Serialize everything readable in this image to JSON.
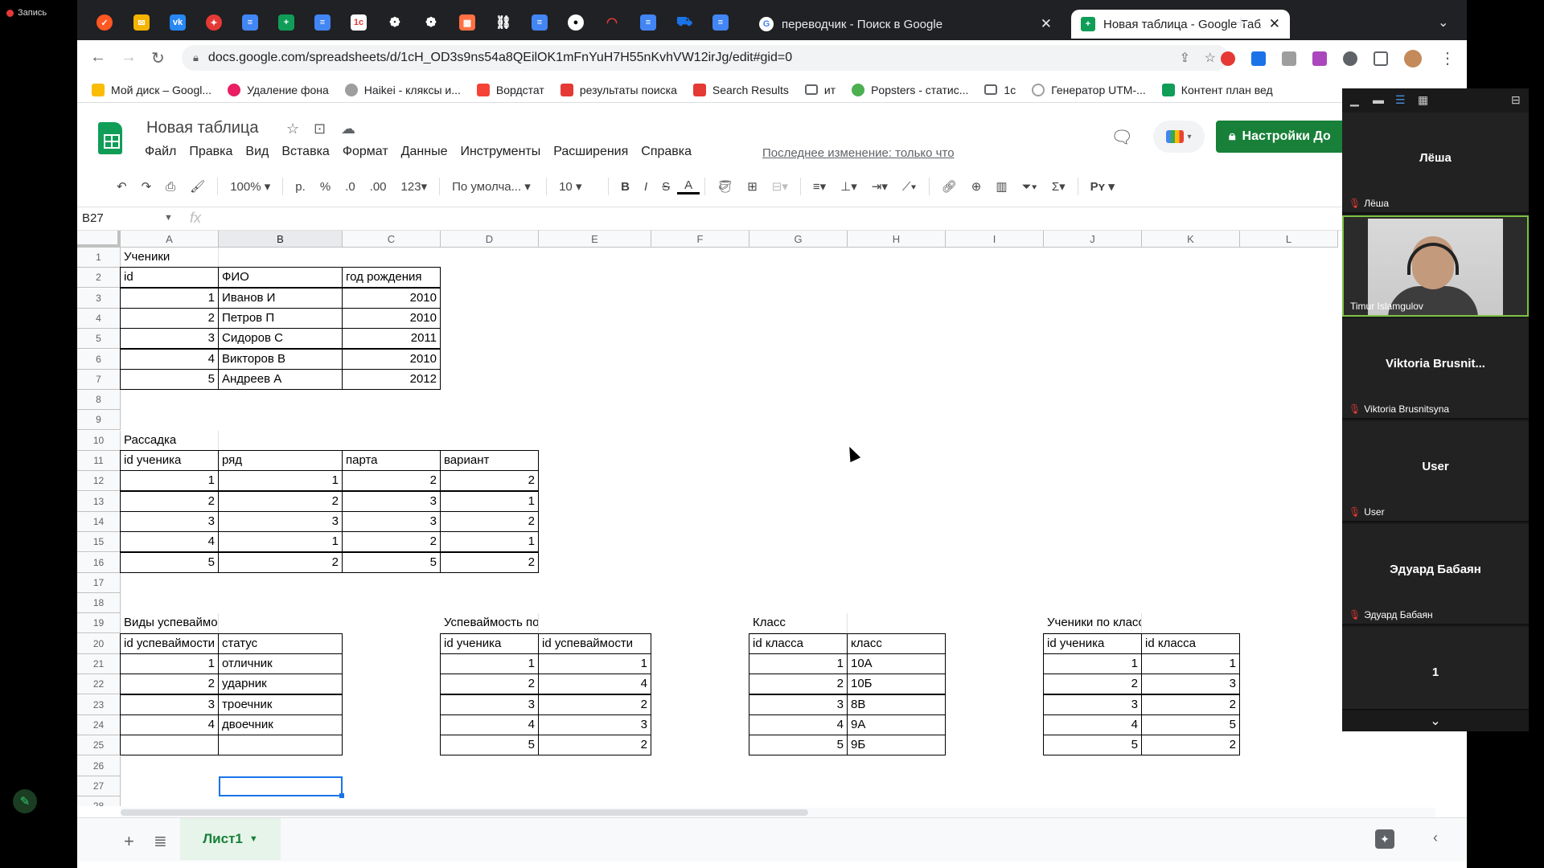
{
  "recording": {
    "label": "Запись"
  },
  "tabs": {
    "items": [
      {
        "title": "переводчик - Поиск в Google"
      },
      {
        "title": "Новая таблица - Google Табли"
      }
    ]
  },
  "address": {
    "url": "docs.google.com/spreadsheets/d/1cH_OD3s9ns54a8QEilOK1mFnYuH7H55nKvhVW12irJg/edit#gid=0"
  },
  "bookmarks": [
    {
      "label": "Мой диск – Googl...",
      "color": "#fbbc04"
    },
    {
      "label": "Удаление фона",
      "color": "#e91e63"
    },
    {
      "label": "Haikei - кляксы и...",
      "color": "#9e9e9e"
    },
    {
      "label": "Вордстат",
      "color": "#f44336"
    },
    {
      "label": "результаты поиска",
      "color": "#e53935"
    },
    {
      "label": "Search Results",
      "color": "#e53935"
    },
    {
      "label": "ит",
      "color": "#ffffff"
    },
    {
      "label": "Popsters - статис...",
      "color": "#4caf50"
    },
    {
      "label": "1с",
      "color": "#ffffff"
    },
    {
      "label": "Генератор UTM-...",
      "color": "#9e9e9e"
    },
    {
      "label": "Контент план вед",
      "color": "#0f9d58"
    }
  ],
  "doc": {
    "title": "Новая таблица",
    "menu": [
      "Файл",
      "Правка",
      "Вид",
      "Вставка",
      "Формат",
      "Данные",
      "Инструменты",
      "Расширения",
      "Справка"
    ],
    "last_edit": "Последнее изменение: только что",
    "share_label": "Настройки До"
  },
  "format_toolbar": {
    "zoom": "100%",
    "currency": "р.",
    "percent": "%",
    "dec_less": ".0",
    "dec_more": ".00",
    "more_formats": "123",
    "font": "По умолча...",
    "font_size": "10",
    "bold": "B",
    "italic": "I",
    "strike": "S",
    "text_color": "A",
    "input_tools": "Рʏ"
  },
  "formula_bar": {
    "name_box": "B27",
    "fx": "fx",
    "content": ""
  },
  "columns": [
    "A",
    "B",
    "C",
    "D",
    "E",
    "F",
    "G",
    "H",
    "I",
    "J",
    "K",
    "L"
  ],
  "rows": [
    "1",
    "2",
    "3",
    "4",
    "5",
    "6",
    "7",
    "8",
    "9",
    "10",
    "11",
    "12",
    "13",
    "14",
    "15",
    "16",
    "17",
    "18",
    "19",
    "20",
    "21",
    "22",
    "23",
    "24",
    "25",
    "26",
    "27",
    "28"
  ],
  "cells": {
    "A1": "Ученики",
    "A2": "id",
    "B2": "ФИО",
    "C2": "год рождения",
    "A3": "1",
    "B3": "Иванов И",
    "C3": "2010",
    "A4": "2",
    "B4": "Петров П",
    "C4": "2010",
    "A5": "3",
    "B5": "Сидоров С",
    "C5": "2011",
    "A6": "4",
    "B6": "Викторов В",
    "C6": "2010",
    "A7": "5",
    "B7": "Андреев А",
    "C7": "2012",
    "A10": "Рассадка",
    "A11": "id ученика",
    "B11": "ряд",
    "C11": "парта",
    "D11": "вариант",
    "A12": "1",
    "B12": "1",
    "C12": "2",
    "D12": "2",
    "A13": "2",
    "B13": "2",
    "C13": "3",
    "D13": "1",
    "A14": "3",
    "B14": "3",
    "C14": "3",
    "D14": "2",
    "A15": "4",
    "B15": "1",
    "C15": "2",
    "D15": "1",
    "A16": "5",
    "B16": "2",
    "C16": "5",
    "D16": "2",
    "A19": "Виды успеваймости",
    "A20": "id успеваймости",
    "B20": "статус",
    "A21": "1",
    "B21": "отличник",
    "A22": "2",
    "B22": "ударник",
    "A23": "3",
    "B23": "троечник",
    "A24": "4",
    "B24": "двоечник",
    "D19": "Успеваймость по ученикам",
    "D20": "id ученика",
    "E20": "id успеваймости",
    "D21": "1",
    "E21": "1",
    "D22": "2",
    "E22": "4",
    "D23": "3",
    "E23": "2",
    "D24": "4",
    "E24": "3",
    "D25": "5",
    "E25": "2",
    "G19": "Класс",
    "G20": "id класса",
    "H20": "класс",
    "G21": "1",
    "H21": "10А",
    "G22": "2",
    "H22": "10Б",
    "G23": "3",
    "H23": "8В",
    "G24": "4",
    "H24": "9А",
    "G25": "5",
    "H25": "9Б",
    "J19": "Ученики по классам",
    "J20": "id ученика",
    "K20": "id класса",
    "J21": "1",
    "K21": "1",
    "J22": "2",
    "K22": "3",
    "J23": "3",
    "K23": "2",
    "J24": "4",
    "K24": "5",
    "J25": "5",
    "K25": "2"
  },
  "sheet_tabs": [
    {
      "label": "Лист1"
    }
  ],
  "participants": [
    {
      "name": "Лёша",
      "label": "Лёша",
      "video": false
    },
    {
      "name": "",
      "label": "Timur Islamgulov",
      "video": true
    },
    {
      "name": "Viktoria  Brusnit...",
      "label": "Viktoria Brusnitsyna",
      "video": false
    },
    {
      "name": "User",
      "label": "User",
      "video": false
    },
    {
      "name": "Эдуард Бабаян",
      "label": "Эдуард Бабаян",
      "video": false
    },
    {
      "name": "1",
      "label": "",
      "video": false
    }
  ],
  "colors": {
    "sheets_green": "#188038",
    "selection_blue": "#1a73e8",
    "active_speaker": "#7cc242"
  }
}
